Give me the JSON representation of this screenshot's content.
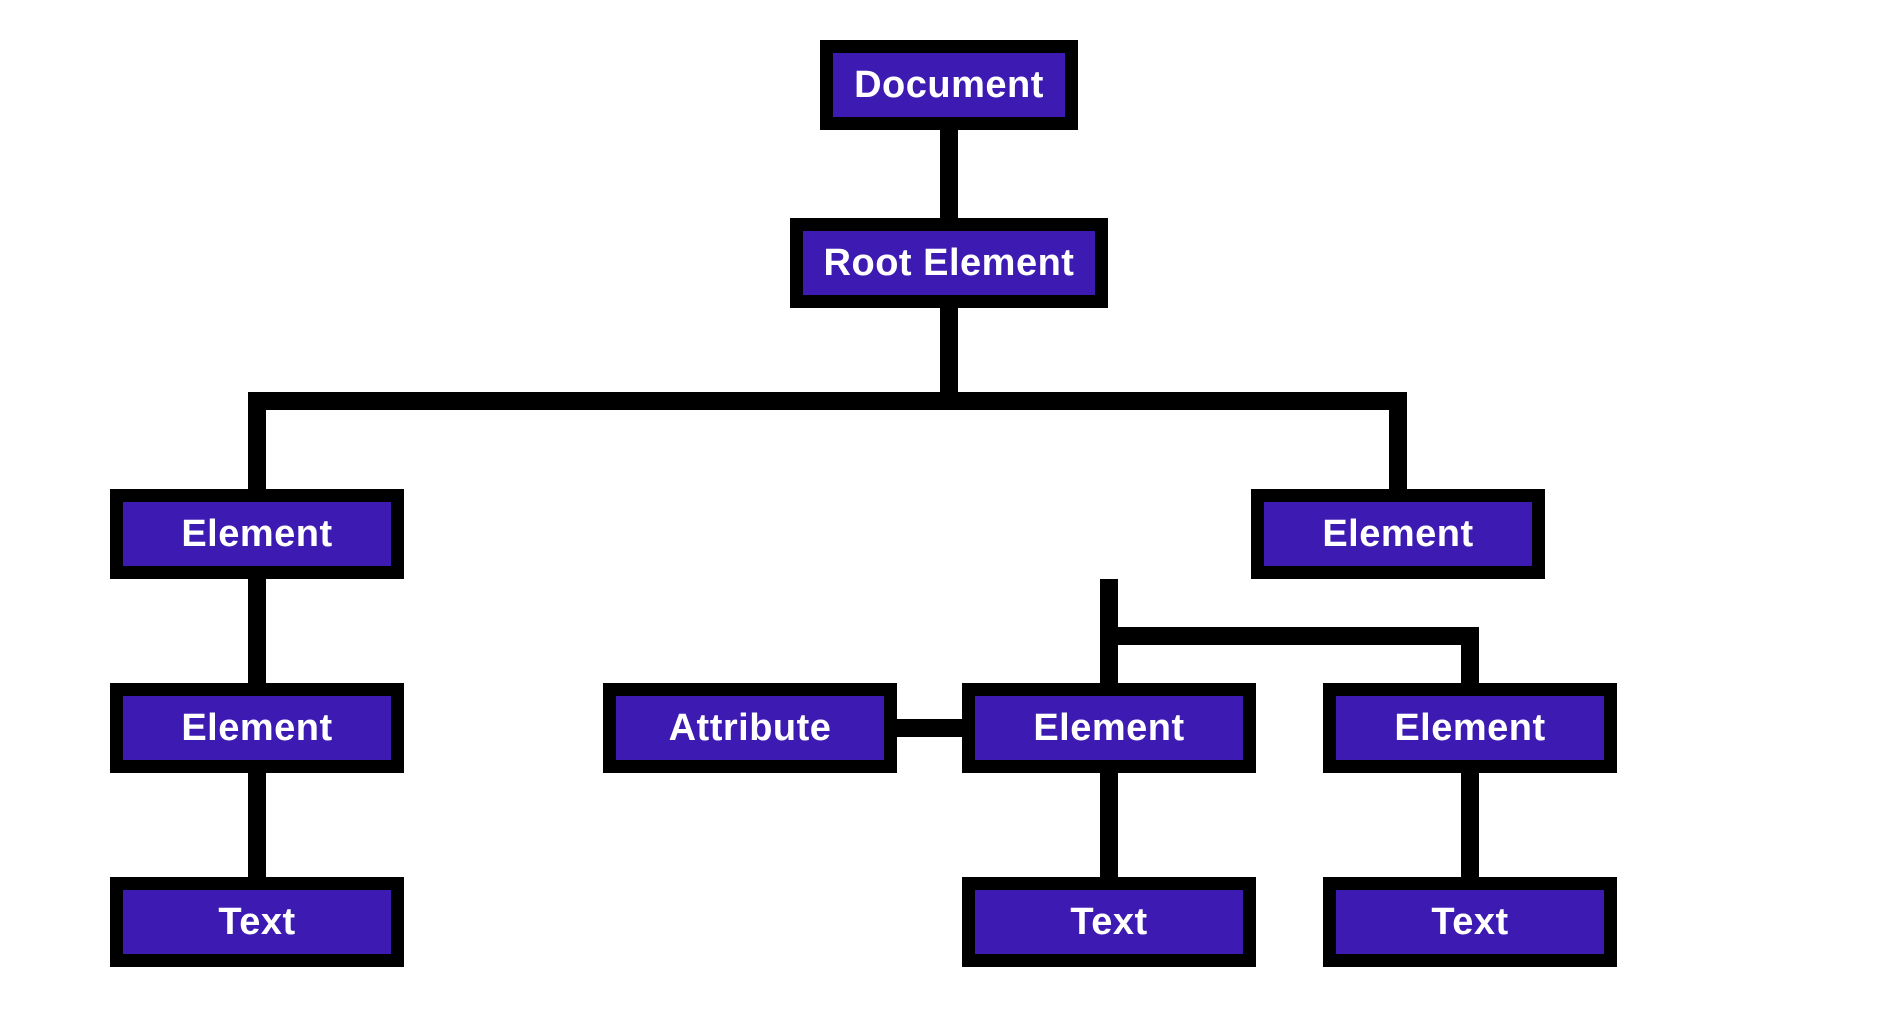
{
  "diagram": {
    "nodes": {
      "document": {
        "label": "Document"
      },
      "root_element": {
        "label": "Root Element"
      },
      "element_left": {
        "label": "Element"
      },
      "element_left_child": {
        "label": "Element"
      },
      "text_left": {
        "label": "Text"
      },
      "element_right": {
        "label": "Element"
      },
      "attribute": {
        "label": "Attribute"
      },
      "element_right_child1": {
        "label": "Element"
      },
      "element_right_child2": {
        "label": "Element"
      },
      "text_mid": {
        "label": "Text"
      },
      "text_right": {
        "label": "Text"
      }
    },
    "colors": {
      "node_fill": "#3d1bb3",
      "node_border": "#000000",
      "edge": "#000000",
      "text": "#ffffff",
      "background": "#ffffff"
    }
  }
}
